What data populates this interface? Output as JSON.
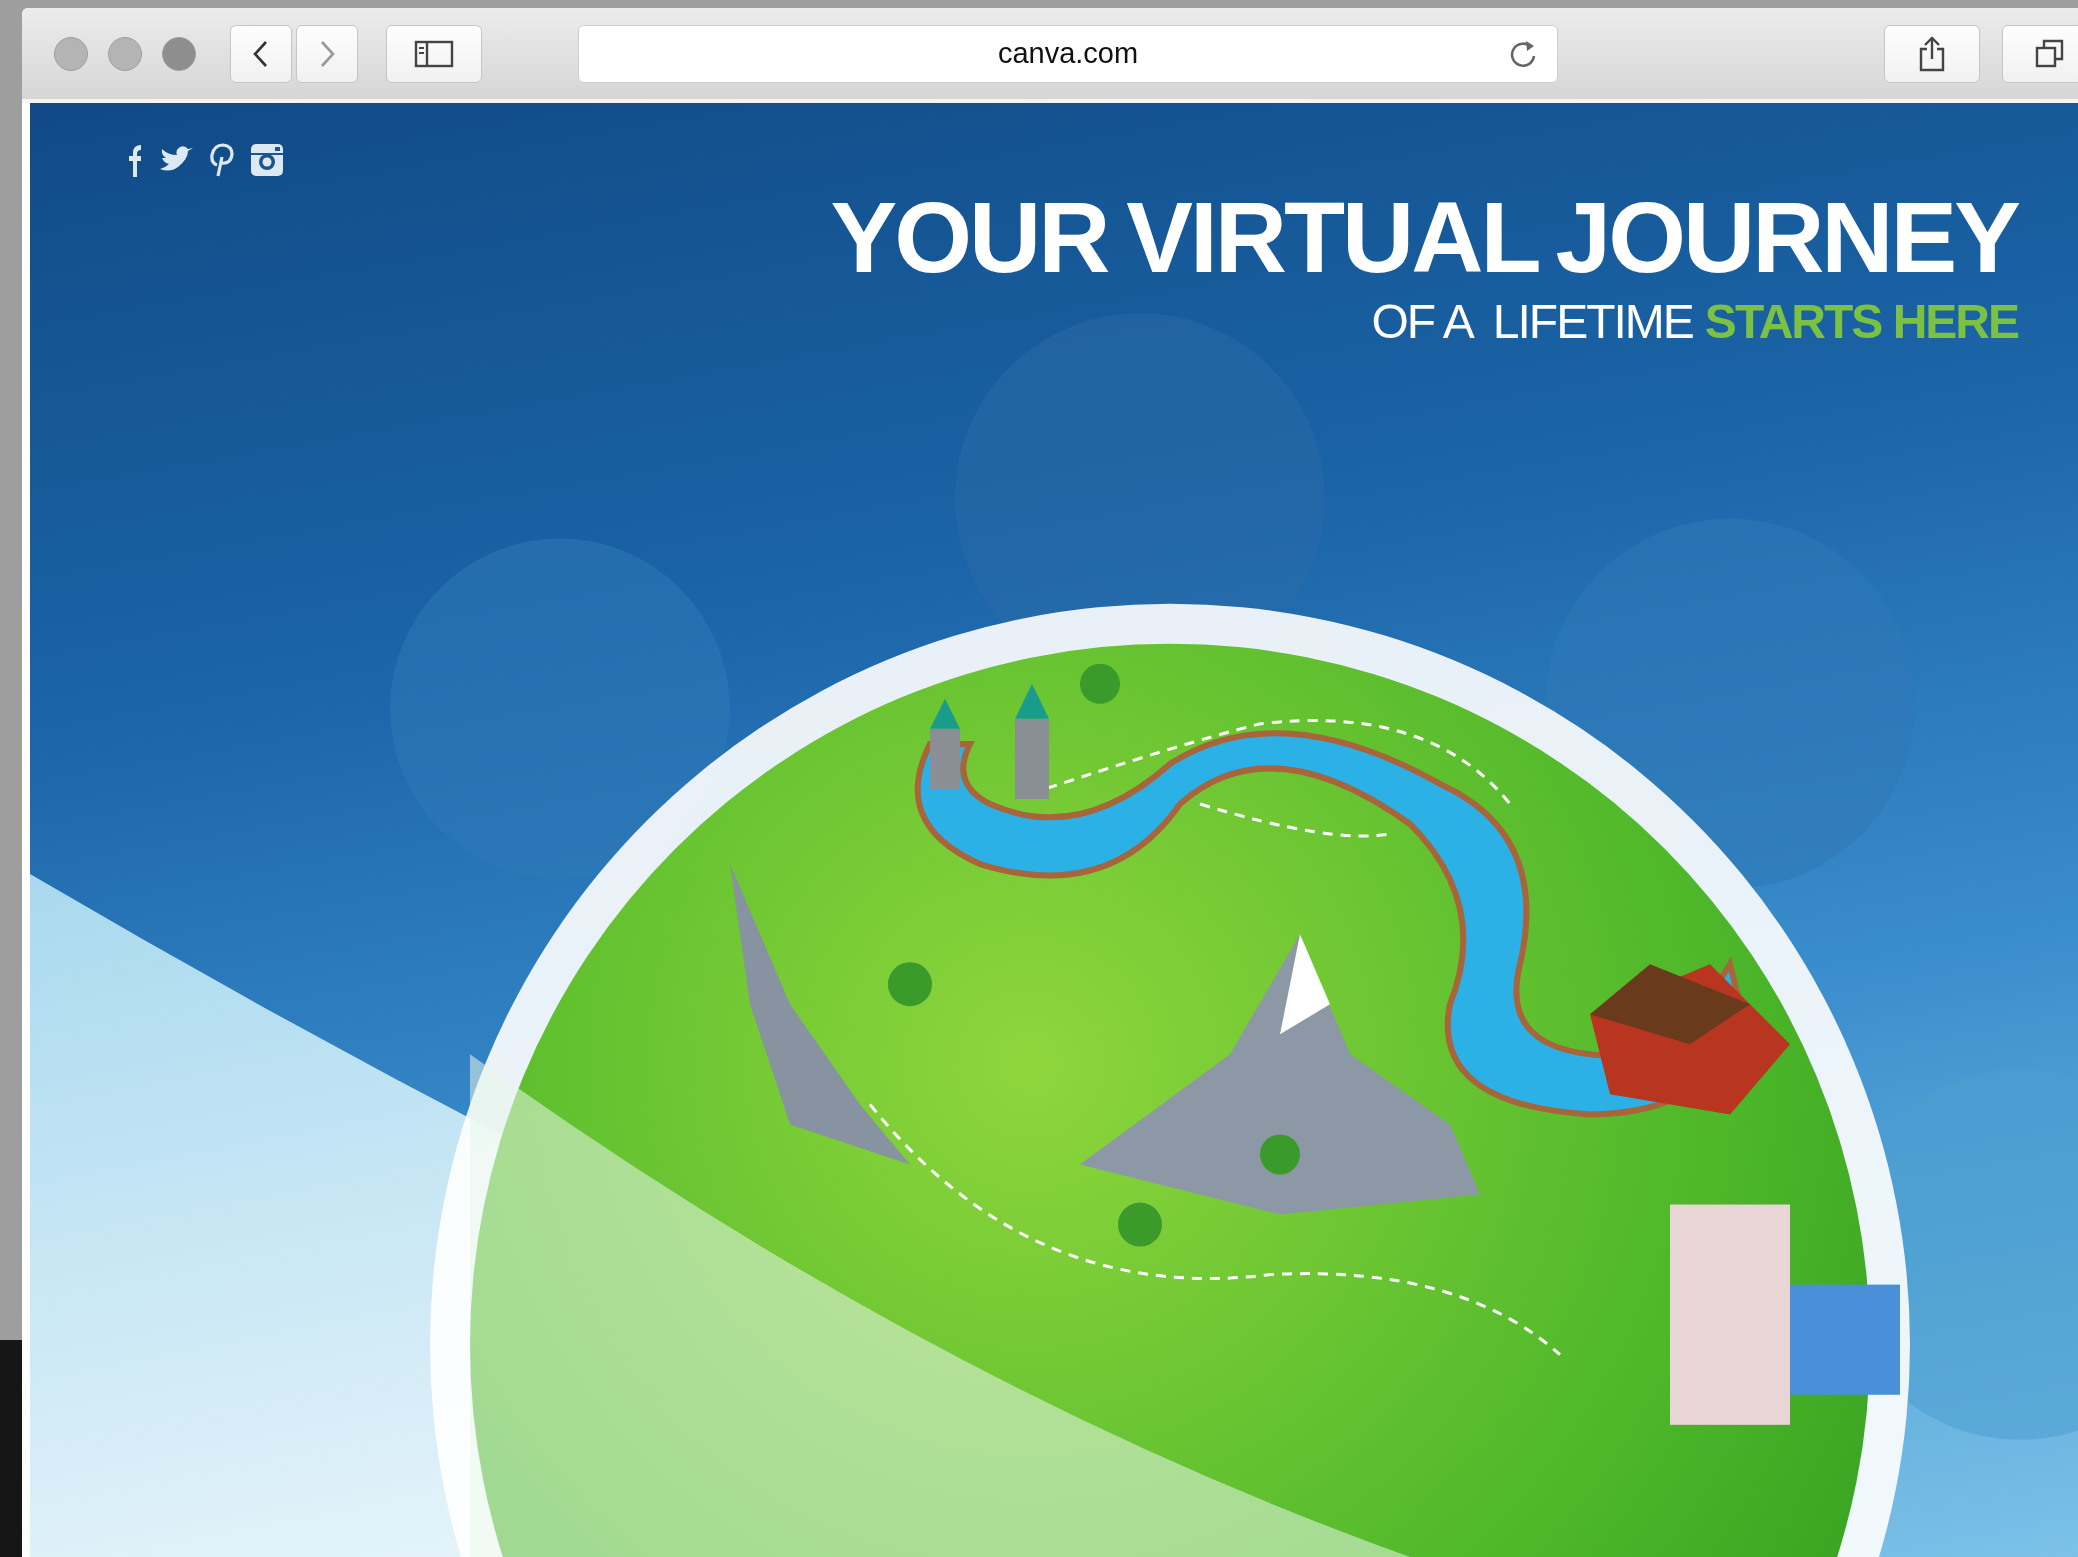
{
  "browser": {
    "url": "canva.com"
  },
  "page": {
    "headline": "YOUR VIRTUAL JOURNEY",
    "tagline": "OF A  LIFETIME",
    "tagline_highlight": "STARTS HERE"
  }
}
